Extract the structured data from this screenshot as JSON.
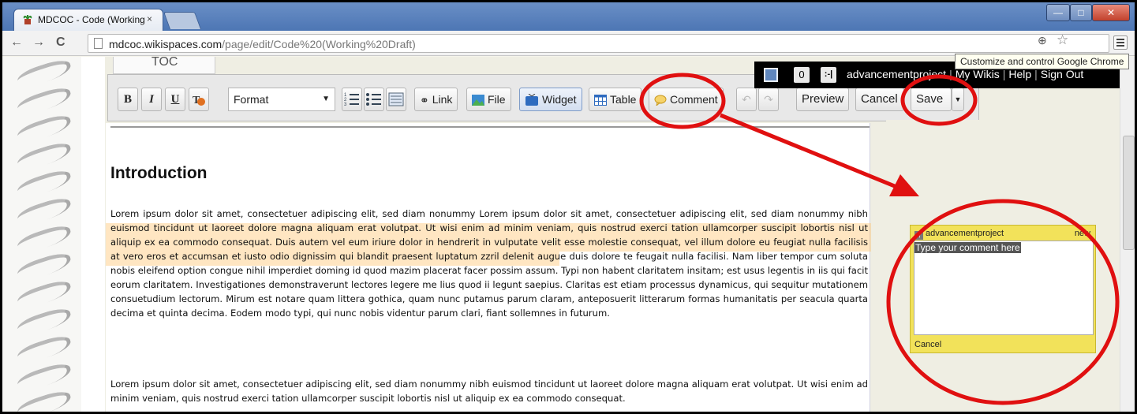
{
  "browser": {
    "tab_title": "MDCOC - Code (Working",
    "tab_close": "×",
    "url_host": "mdcoc.wikispaces.com",
    "url_path": "/page/edit/Code%20(Working%20Draft)",
    "tooltip": "Customize and control Google Chrome",
    "back": "←",
    "forward": "→",
    "reload": "C"
  },
  "userbar": {
    "count": "0",
    "username": "advancementproject",
    "my_wikis": "My Wikis",
    "help": "Help",
    "sign_out": "Sign Out",
    "sep": "|"
  },
  "toc_label": "TOC",
  "toolbar": {
    "bold": "B",
    "italic": "I",
    "underline": "U",
    "format": "Format",
    "link": "Link",
    "file": "File",
    "widget": "Widget",
    "table": "Table",
    "comment": "Comment",
    "preview": "Preview",
    "cancel": "Cancel",
    "save": "Save"
  },
  "content": {
    "heading": "Introduction",
    "para1": "Lorem ipsum dolor sit amet, consectetuer adipiscing elit, sed diam nonummy Lorem ipsum dolor sit amet, consectetuer adipiscing elit, sed diam nonummy nibh euismod tincidunt ut laoreet dolore magna aliquam erat volutpat. Ut wisi enim ad minim veniam, quis nostrud exerci tation ullamcorper suscipit lobortis nisl ut aliquip ex ea commodo consequat. Duis autem vel eum iriure dolor in hendrerit in vulputate velit esse molestie consequat, vel illum dolore eu feugiat nulla facilisis at vero eros et accumsan et iusto odio dignissim qui blandit praesent luptatum zzril delenit augue duis dolore te feugait nulla facilisi. Nam liber tempor cum soluta nobis eleifend option congue nihil imperdiet doming id quod mazim placerat facer possim assum. Typi non habent claritatem insitam; est usus legentis in iis qui facit eorum claritatem. Investigationes demonstraverunt lectores legere me lius quod ii legunt saepius. Claritas est etiam processus dynamicus, qui sequitur mutationem consuetudium lectorum. Mirum est notare quam littera gothica, quam nunc putamus parum claram, anteposuerit litterarum formas humanitatis per seacula quarta decima et quinta decima. Eodem modo typi, qui nunc nobis videntur parum clari, fiant sollemnes in futurum.",
    "para2": "Lorem ipsum dolor sit amet, consectetuer adipiscing elit, sed diam nonummy nibh euismod tincidunt ut laoreet dolore magna aliquam erat volutpat. Ut wisi enim ad minim veniam, quis nostrud exerci tation ullamcorper suscipit lobortis nisl ut aliquip ex ea commodo consequat."
  },
  "comment_box": {
    "username": "advancementproject",
    "badge": "new",
    "placeholder": "Type your comment here",
    "cancel": "Cancel"
  },
  "colors": {
    "annotation_red": "#e01010",
    "highlight": "#ffc878",
    "comment_yellow": "#f2e25a"
  }
}
